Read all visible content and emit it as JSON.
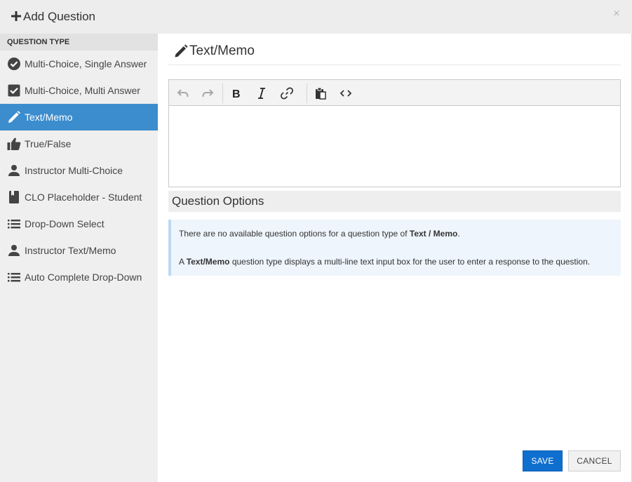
{
  "header": {
    "title": "Add Question",
    "icon": "plus-icon",
    "close_label": "×"
  },
  "sidebar": {
    "heading": "QUESTION TYPE",
    "items": [
      {
        "label": "Multi-Choice, Single Answer",
        "icon": "check-circle-icon",
        "active": false
      },
      {
        "label": "Multi-Choice, Multi Answer",
        "icon": "check-square-icon",
        "active": false
      },
      {
        "label": "Text/Memo",
        "icon": "pencil-icon",
        "active": true
      },
      {
        "label": "True/False",
        "icon": "thumbs-up-icon",
        "active": false
      },
      {
        "label": "Instructor Multi-Choice",
        "icon": "person-icon",
        "active": false
      },
      {
        "label": "CLO Placeholder - Student",
        "icon": "book-icon",
        "active": false
      },
      {
        "label": "Drop-Down Select",
        "icon": "list-icon",
        "active": false
      },
      {
        "label": "Instructor Text/Memo",
        "icon": "person-icon",
        "active": false
      },
      {
        "label": "Auto Complete Drop-Down",
        "icon": "list-icon",
        "active": false
      }
    ]
  },
  "main": {
    "title": "Text/Memo",
    "title_icon": "pencil-icon",
    "editor": {
      "content": "",
      "toolbar": [
        "undo-icon",
        "redo-icon",
        "bold-icon",
        "italic-icon",
        "link-icon",
        "paste-icon",
        "code-icon"
      ]
    },
    "options": {
      "heading": "Question Options",
      "line1_prefix": "There are no available question options for a question type of ",
      "line1_bold": "Text / Memo",
      "line1_suffix": ".",
      "line2_prefix": "A ",
      "line2_bold": "Text/Memo",
      "line2_suffix": " question type displays a multi-line text input box for the user to enter a response to the question."
    }
  },
  "footer": {
    "save_label": "SAVE",
    "cancel_label": "CANCEL"
  },
  "colors": {
    "accent": "#3c8dce",
    "save_button": "#0f6fcf",
    "header_bg": "#ededed",
    "sidebar_bg": "#efefef",
    "notice_bg": "#eef5fc"
  }
}
